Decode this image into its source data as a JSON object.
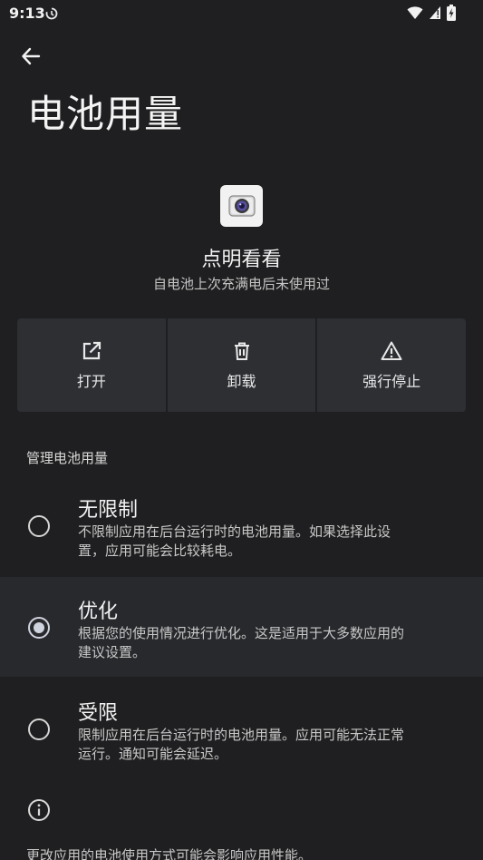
{
  "status_bar": {
    "time": "9:13",
    "sync_icon": "sync-icon",
    "icons": [
      "wifi-icon",
      "signal-icon",
      "battery-icon"
    ]
  },
  "header": {
    "title": "电池用量",
    "back_icon": "arrow-left-icon"
  },
  "app": {
    "name": "点明看看",
    "subtitle": "自电池上次充满电后未使用过",
    "icon": "camera-app-icon"
  },
  "actions": [
    {
      "label": "打开",
      "icon": "open-external-icon"
    },
    {
      "label": "卸载",
      "icon": "trash-icon"
    },
    {
      "label": "强行停止",
      "icon": "warning-icon"
    }
  ],
  "section": {
    "label": "管理电池用量"
  },
  "options": [
    {
      "title": "无限制",
      "line1": "不限制应用在后台运行时的电池用量。如果选择此设",
      "line2": "置，应用可能会比较耗电。",
      "selected": false
    },
    {
      "title": "优化",
      "line1": "根据您的使用情况进行优化。这是适用于大多数应用的",
      "line2": "建议设置。",
      "selected": true
    },
    {
      "title": "受限",
      "line1": "限制应用在后台运行时的电池用量。应用可能无法正常",
      "line2": "运行。通知可能会延迟。",
      "selected": false
    }
  ],
  "footer": {
    "text": "更改应用的电池使用方式可能会影响应用性能。",
    "icon": "info-icon"
  },
  "colors": {
    "background": "#1f1f21",
    "button_bg": "#2d2f33",
    "selected_row": "#28292c",
    "accent": "#cfd3de"
  }
}
